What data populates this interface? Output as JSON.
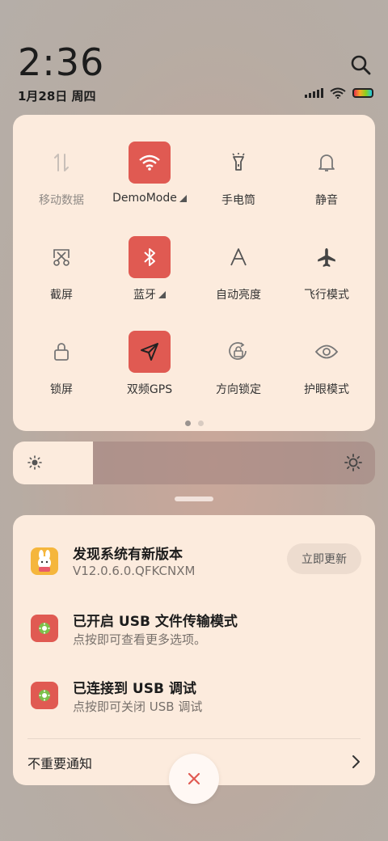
{
  "header": {
    "time": "2:36",
    "date": "1月28日 周四"
  },
  "quick_settings": {
    "tiles": [
      {
        "label": "移动数据",
        "icon": "mobile-data-icon",
        "active": false,
        "disabled": true
      },
      {
        "label": "DemoMode",
        "icon": "wifi-icon",
        "active": true,
        "expand": true
      },
      {
        "label": "手电筒",
        "icon": "flashlight-icon",
        "active": false
      },
      {
        "label": "静音",
        "icon": "bell-icon",
        "active": false
      },
      {
        "label": "截屏",
        "icon": "screenshot-icon",
        "active": false
      },
      {
        "label": "蓝牙",
        "icon": "bluetooth-icon",
        "active": true,
        "expand": true
      },
      {
        "label": "自动亮度",
        "icon": "auto-brightness-icon",
        "active": false
      },
      {
        "label": "飞行模式",
        "icon": "airplane-icon",
        "active": false
      },
      {
        "label": "锁屏",
        "icon": "lock-icon",
        "active": false
      },
      {
        "label": "双频GPS",
        "icon": "gps-icon",
        "active": true
      },
      {
        "label": "方向锁定",
        "icon": "rotation-lock-icon",
        "active": false
      },
      {
        "label": "护眼模式",
        "icon": "eye-icon",
        "active": false
      }
    ],
    "page_count": 2,
    "current_page": 1
  },
  "brightness": {
    "level": 0.22
  },
  "notifications": [
    {
      "title": "发现系统有新版本",
      "subtitle": "V12.0.6.0.QFKCNXM",
      "icon": "updater-app-icon",
      "action_label": "立即更新"
    },
    {
      "title": "已开启 USB 文件传输模式",
      "subtitle": "点按即可查看更多选项。",
      "icon": "android-settings-icon"
    },
    {
      "title": "已连接到 USB 调试",
      "subtitle": "点按即可关闭 USB 调试",
      "icon": "android-settings-icon"
    }
  ],
  "footer": {
    "unimportant_label": "不重要通知"
  },
  "colors": {
    "accent": "#e05a52",
    "panel": "#fcebdd",
    "clear": "#e05a52"
  }
}
